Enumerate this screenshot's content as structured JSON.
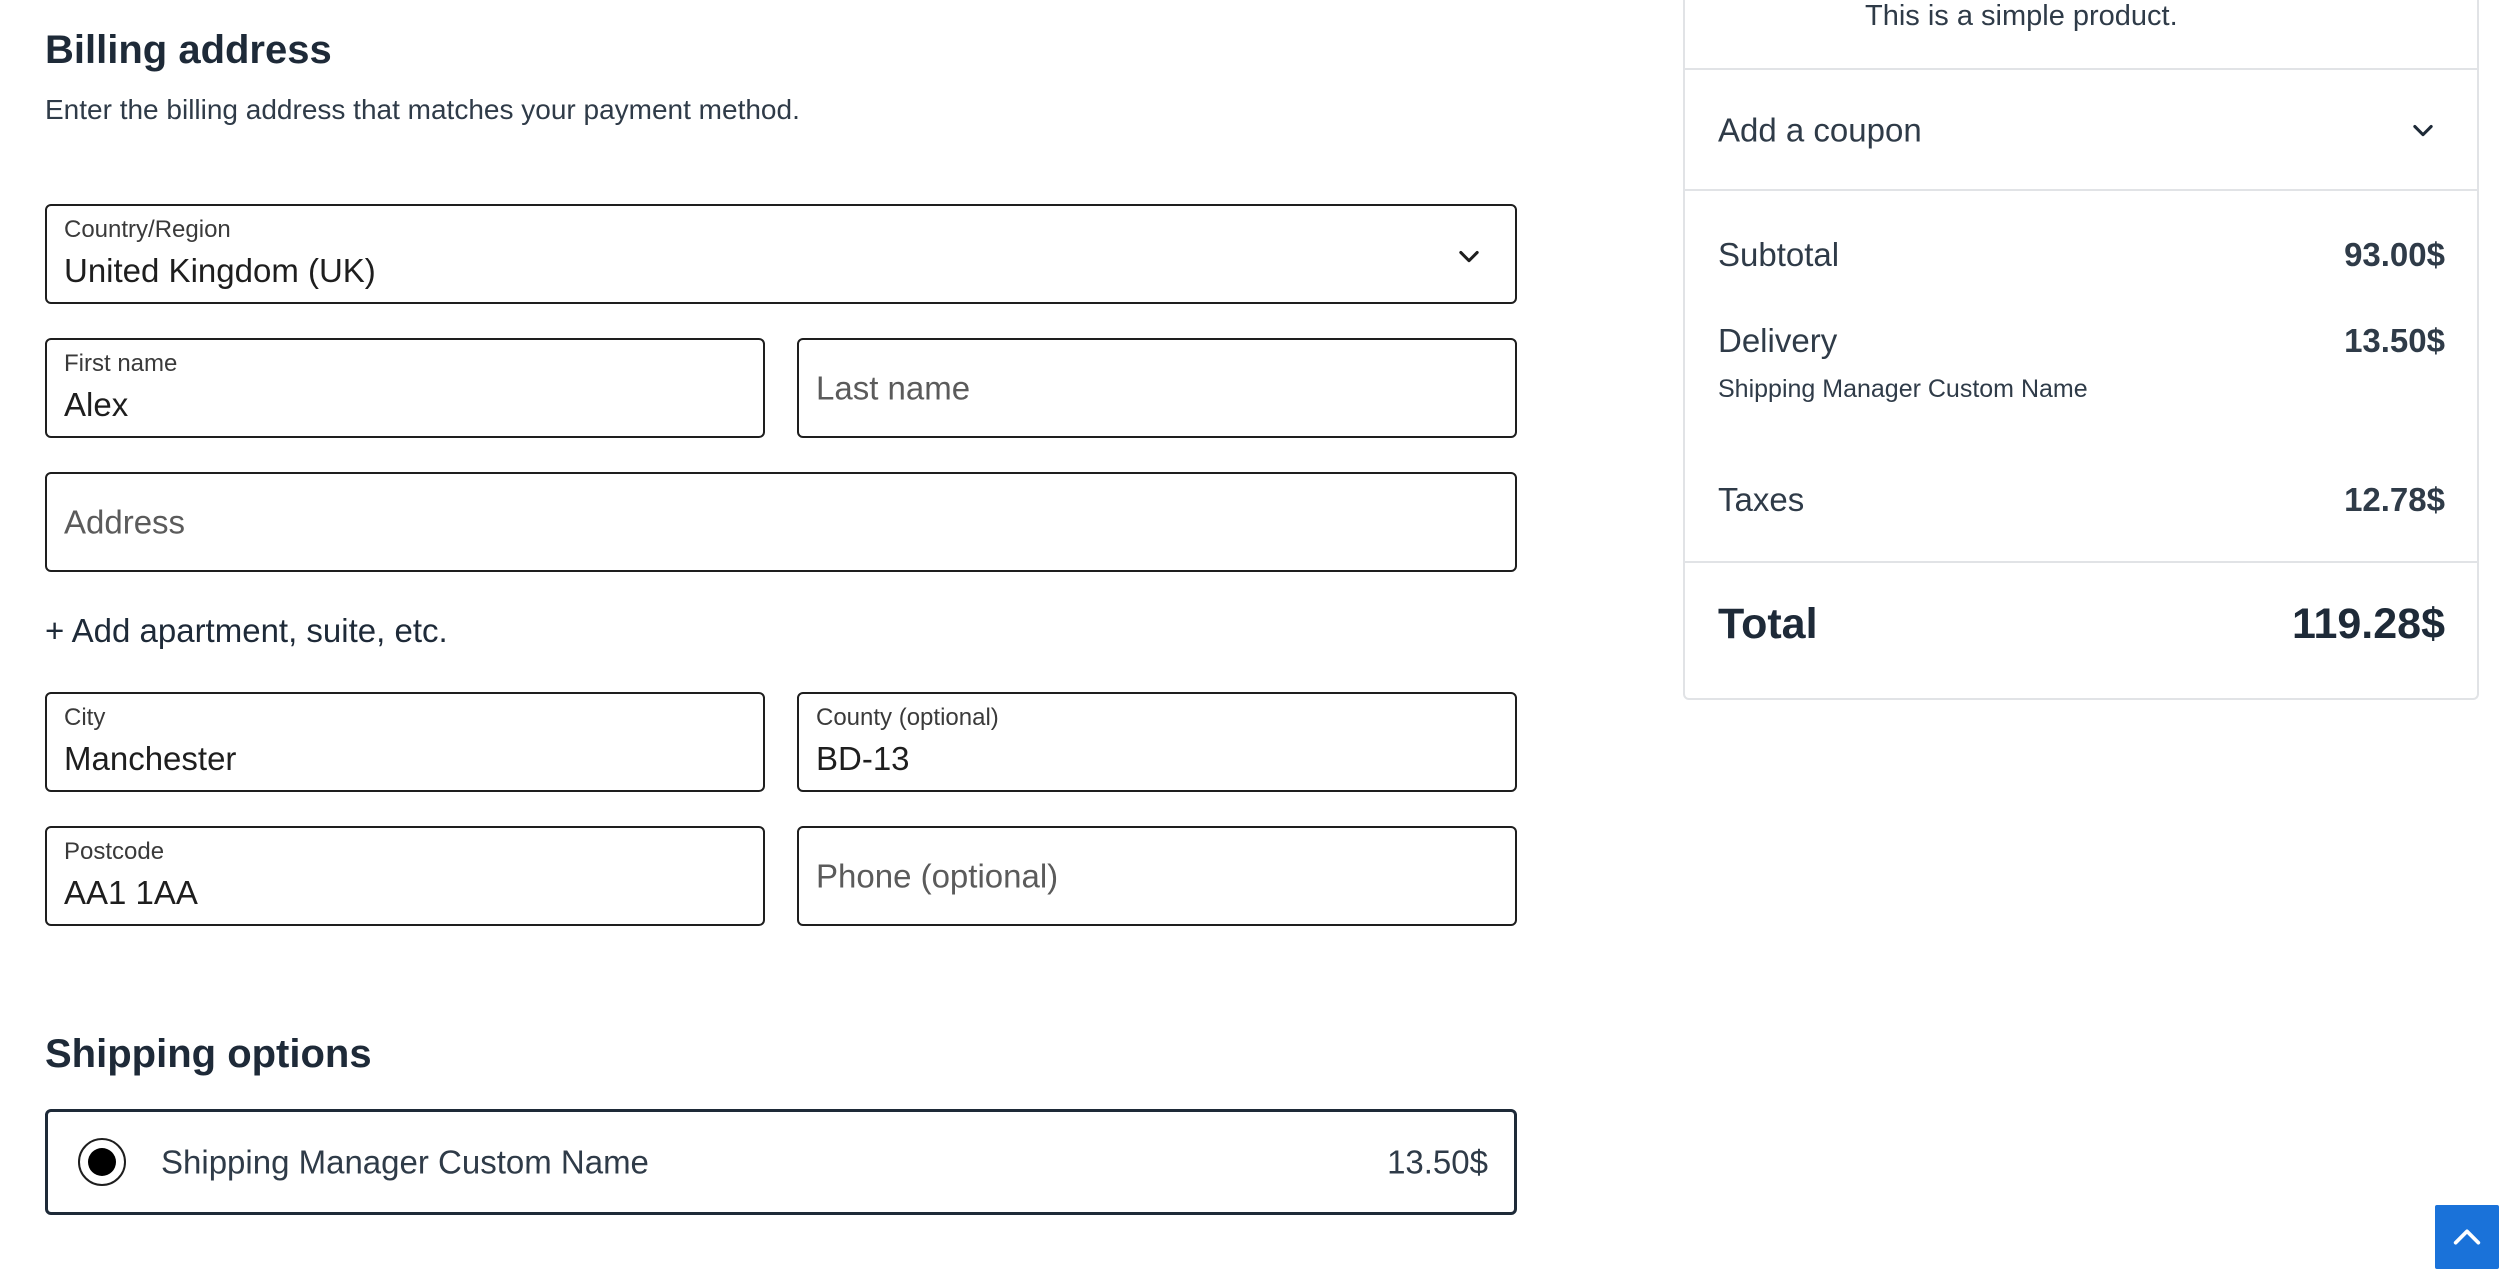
{
  "billing": {
    "heading": "Billing address",
    "description": "Enter the billing address that matches your payment method.",
    "country": {
      "label": "Country/Region",
      "value": "United Kingdom (UK)",
      "icon": "chevron-down-icon"
    },
    "first_name": {
      "label": "First name",
      "value": "Alex"
    },
    "last_name": {
      "placeholder": "Last name"
    },
    "address": {
      "placeholder": "Address"
    },
    "add_apartment": "+ Add apartment, suite, etc.",
    "city": {
      "label": "City",
      "value": "Manchester"
    },
    "county": {
      "label": "County (optional)",
      "value": "BD-13"
    },
    "postcode": {
      "label": "Postcode",
      "value": "AA1 1AA"
    },
    "phone": {
      "placeholder": "Phone (optional)"
    }
  },
  "shipping": {
    "heading": "Shipping options",
    "option": {
      "name": "Shipping Manager Custom Name",
      "price": "13.50$",
      "selected": true
    }
  },
  "summary": {
    "product_description": "This is a simple product.",
    "coupon_label": "Add a coupon",
    "coupon_icon": "chevron-down-icon",
    "subtotal": {
      "label": "Subtotal",
      "value": "93.00$"
    },
    "delivery": {
      "label": "Delivery",
      "value": "13.50$",
      "method": "Shipping Manager Custom Name"
    },
    "taxes": {
      "label": "Taxes",
      "value": "12.78$"
    },
    "total": {
      "label": "Total",
      "value": "119.28$"
    }
  },
  "back_to_top": {
    "icon": "chevron-up-icon"
  },
  "colors": {
    "text_dark": "#1e2a38",
    "border": "#1e1e1e",
    "divider": "#e1e3e6",
    "accent_blue": "#1a72d9"
  }
}
